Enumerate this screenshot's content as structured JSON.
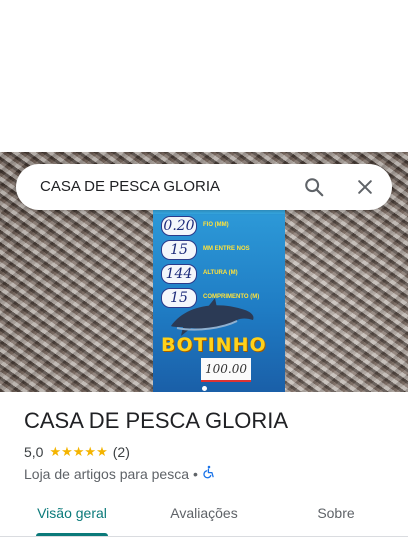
{
  "search": {
    "query": "CASA DE PESCA GLORIA"
  },
  "photo": {
    "label_values": [
      "0.20",
      "15",
      "144",
      "15"
    ],
    "label_specs": [
      "FIO (MM)",
      "MM ENTRE NOS",
      "ALTURA (M)",
      "COMPRIMENTO (M)"
    ],
    "brand": "BOTINHO",
    "price": "100.00"
  },
  "place": {
    "name": "CASA DE PESCA GLORIA",
    "rating": "5,0",
    "stars": "★★★★★",
    "review_count": "(2)",
    "category": "Loja de artigos para pesca",
    "separator": "•"
  },
  "tabs": [
    {
      "label": "Visão geral",
      "active": true
    },
    {
      "label": "Avaliações",
      "active": false
    },
    {
      "label": "Sobre",
      "active": false
    }
  ],
  "colors": {
    "accent": "#0b7a7a",
    "star": "#f4b400",
    "accessibility": "#1a73e8"
  }
}
